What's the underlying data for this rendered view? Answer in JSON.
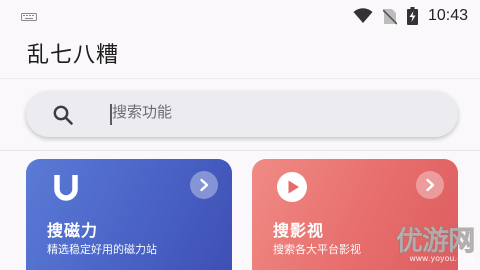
{
  "status_bar": {
    "time": "10:43",
    "icons": [
      "keyboard-icon",
      "wifi-icon",
      "no-sim-icon",
      "battery-charging-icon"
    ]
  },
  "header": {
    "title": "乱七八糟"
  },
  "search": {
    "placeholder": "搜索功能"
  },
  "cards": [
    {
      "title": "搜磁力",
      "subtitle": "精选稳定好用的磁力站",
      "icon": "magnet-icon",
      "accent_from": "#5a7bd6",
      "accent_to": "#3f4fb4"
    },
    {
      "title": "搜影视",
      "subtitle": "搜索各大平台影视",
      "icon": "play-icon",
      "accent_from": "#f08b85",
      "accent_to": "#dd5d60"
    }
  ],
  "watermark": {
    "name": "优游网",
    "url": "www.yoyou.com"
  }
}
